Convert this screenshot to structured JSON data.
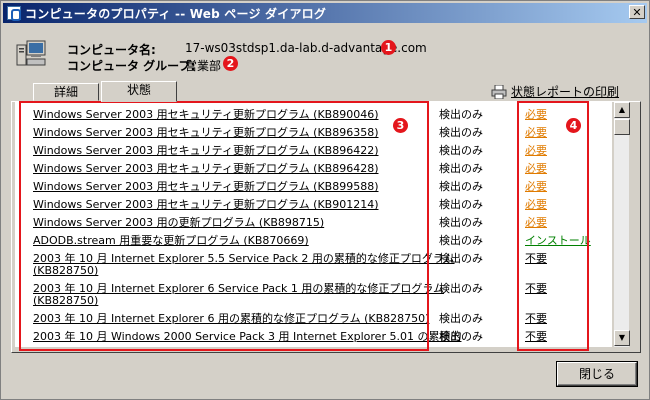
{
  "window": {
    "title": "コンピュータのプロパティ -- Web ページ ダイアログ",
    "close_glyph": "✕"
  },
  "info": {
    "computer_name_label": "コンピュータ名:",
    "computer_name_value": "17-ws03stdsp1.da-lab.d-advantage.com",
    "group_label": "コンピュータ グループ:",
    "group_value": "営業部"
  },
  "badges": [
    "1",
    "2",
    "3",
    "4"
  ],
  "tabs": [
    {
      "label": "詳細"
    },
    {
      "label": "状態"
    }
  ],
  "print_link": "状態レポートの印刷",
  "updates": [
    {
      "name": "Windows Server 2003 用セキュリティ更新プログラム (KB890046)",
      "mode": "検出のみ",
      "status": "必要",
      "kind": "need"
    },
    {
      "name": "Windows Server 2003 用セキュリティ更新プログラム (KB896358)",
      "mode": "検出のみ",
      "status": "必要",
      "kind": "need"
    },
    {
      "name": "Windows Server 2003 用セキュリティ更新プログラム (KB896422)",
      "mode": "検出のみ",
      "status": "必要",
      "kind": "need"
    },
    {
      "name": "Windows Server 2003 用セキュリティ更新プログラム (KB896428)",
      "mode": "検出のみ",
      "status": "必要",
      "kind": "need"
    },
    {
      "name": "Windows Server 2003 用セキュリティ更新プログラム (KB899588)",
      "mode": "検出のみ",
      "status": "必要",
      "kind": "need"
    },
    {
      "name": "Windows Server 2003 用セキュリティ更新プログラム (KB901214)",
      "mode": "検出のみ",
      "status": "必要",
      "kind": "need"
    },
    {
      "name": "Windows Server 2003 用の更新プログラム (KB898715)",
      "mode": "検出のみ",
      "status": "必要",
      "kind": "need"
    },
    {
      "name": "ADODB.stream 用重要な更新プログラム (KB870669)",
      "mode": "検出のみ",
      "status": "インストール",
      "kind": "install"
    },
    {
      "name": "2003 年 10 月 Internet Explorer 5.5 Service Pack 2 用の累積的な修正プログラム",
      "name2": "(KB828750)",
      "mode": "検出のみ",
      "status": "不要",
      "kind": "none"
    },
    {
      "name": "2003 年 10 月 Internet Explorer 6 Service Pack 1 用の累積的な修正プログラム",
      "name2": "(KB828750)",
      "mode": "検出のみ",
      "status": "不要",
      "kind": "none"
    },
    {
      "name": "2003 年 10 月 Internet Explorer 6 用の累積的な修正プログラム (KB828750)",
      "mode": "検出のみ",
      "status": "不要",
      "kind": "none"
    },
    {
      "name": "2003 年 10 月 Windows 2000 Service Pack 3 用 Internet Explorer 5.01 の累積的",
      "mode": "検出のみ",
      "status": "不要",
      "kind": "none"
    }
  ],
  "colors": {
    "need": "#e07b00",
    "install": "#008000",
    "annotation": "#e4161c"
  },
  "buttons": {
    "close": "閉じる"
  }
}
